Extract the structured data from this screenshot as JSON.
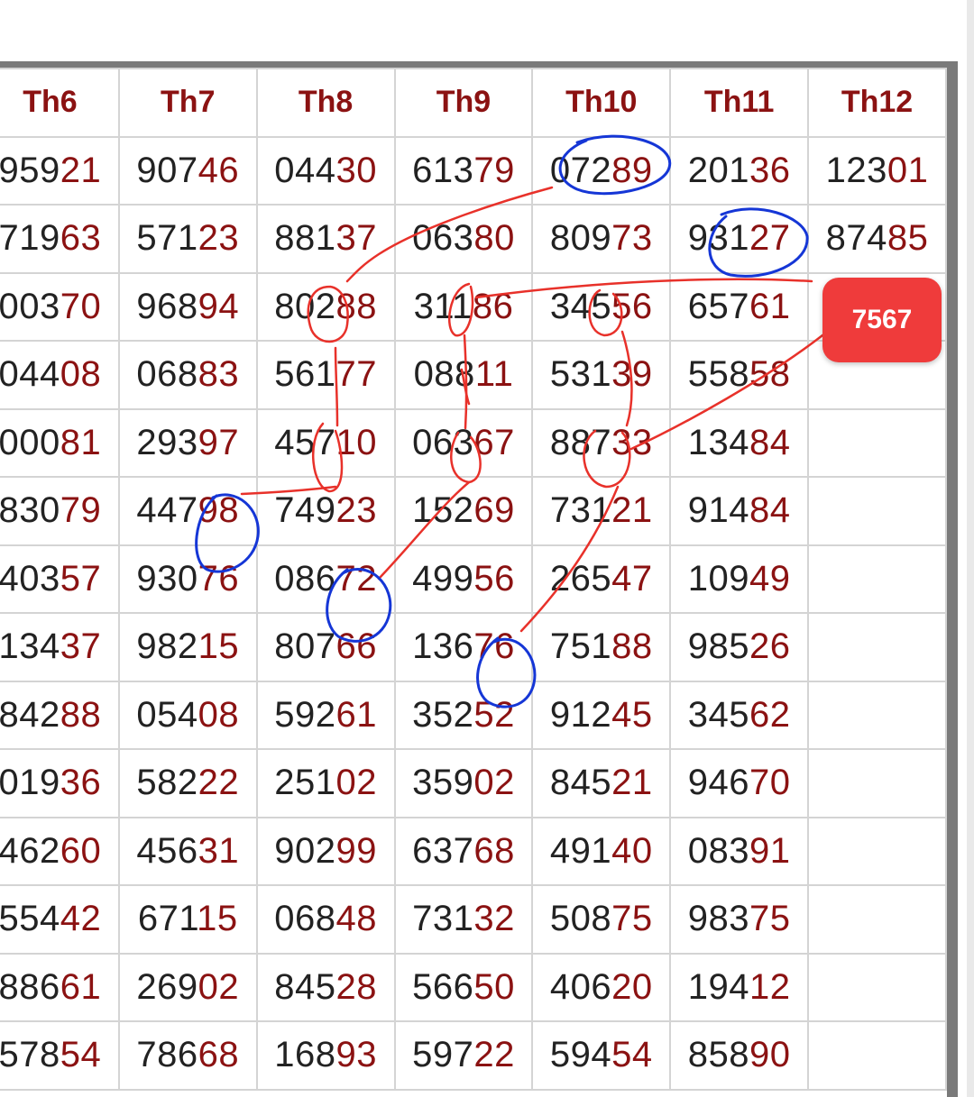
{
  "table": {
    "headers": [
      "Th6",
      "Th7",
      "Th8",
      "Th9",
      "Th10",
      "Th11",
      "Th12"
    ],
    "rows": [
      [
        [
          "959",
          "21",
          ""
        ],
        [
          "907",
          "46",
          ""
        ],
        [
          "044",
          "30",
          ""
        ],
        [
          "613",
          "79",
          ""
        ],
        [
          "072",
          "89",
          "orange"
        ],
        [
          "201",
          "36",
          ""
        ],
        [
          "123",
          "01",
          ""
        ]
      ],
      [
        [
          "719",
          "63",
          ""
        ],
        [
          "571",
          "23",
          "green"
        ],
        [
          "881",
          "37",
          ""
        ],
        [
          "063",
          "80",
          ""
        ],
        [
          "809",
          "73",
          ""
        ],
        [
          "931",
          "27",
          "orange"
        ],
        [
          "874",
          "85",
          ""
        ]
      ],
      [
        [
          "003",
          "70",
          ""
        ],
        [
          "968",
          "94",
          ""
        ],
        [
          "802",
          "88",
          ""
        ],
        [
          "311",
          "86",
          "green"
        ],
        [
          "345",
          "56",
          ""
        ],
        [
          "657",
          "61",
          ""
        ],
        [
          "",
          "",
          "orange"
        ]
      ],
      [
        [
          "044",
          "08",
          "green"
        ],
        [
          "068",
          "83",
          ""
        ],
        [
          "561",
          "77",
          ""
        ],
        [
          "088",
          "11",
          ""
        ],
        [
          "531",
          "39",
          ""
        ],
        [
          "558",
          "58",
          ""
        ],
        [
          "",
          "",
          ""
        ]
      ],
      [
        [
          "000",
          "81",
          ""
        ],
        [
          "293",
          "97",
          ""
        ],
        [
          "457",
          "10",
          ""
        ],
        [
          "063",
          "67",
          ""
        ],
        [
          "887",
          "33",
          ""
        ],
        [
          "134",
          "84",
          "green"
        ],
        [
          "",
          "",
          ""
        ]
      ],
      [
        [
          "830",
          "79",
          ""
        ],
        [
          "447",
          "98",
          "orange"
        ],
        [
          "749",
          "23",
          "green"
        ],
        [
          "152",
          "69",
          ""
        ],
        [
          "731",
          "21",
          ""
        ],
        [
          "914",
          "84",
          ""
        ],
        [
          "",
          "",
          ""
        ]
      ],
      [
        [
          "403",
          "57",
          ""
        ],
        [
          "930",
          "76",
          ""
        ],
        [
          "086",
          "72",
          "orange"
        ],
        [
          "499",
          "56",
          ""
        ],
        [
          "265",
          "47",
          ""
        ],
        [
          "109",
          "49",
          ""
        ],
        [
          "",
          "",
          ""
        ]
      ],
      [
        [
          "134",
          "37",
          ""
        ],
        [
          "982",
          "15",
          ""
        ],
        [
          "807",
          "66",
          ""
        ],
        [
          "136",
          "76",
          "orange"
        ],
        [
          "751",
          "88",
          "green"
        ],
        [
          "985",
          "26",
          ""
        ],
        [
          "",
          "",
          ""
        ]
      ],
      [
        [
          "842",
          "88",
          ""
        ],
        [
          "054",
          "08",
          "green"
        ],
        [
          "592",
          "61",
          ""
        ],
        [
          "352",
          "52",
          ""
        ],
        [
          "912",
          "45",
          ""
        ],
        [
          "345",
          "62",
          ""
        ],
        [
          "",
          "",
          ""
        ]
      ],
      [
        [
          "019",
          "36",
          ""
        ],
        [
          "582",
          "22",
          ""
        ],
        [
          "251",
          "02",
          ""
        ],
        [
          "359",
          "02",
          "green"
        ],
        [
          "845",
          "21",
          ""
        ],
        [
          "946",
          "70",
          ""
        ],
        [
          "",
          "",
          "green"
        ]
      ],
      [
        [
          "462",
          "60",
          "green"
        ],
        [
          "456",
          "31",
          ""
        ],
        [
          "902",
          "99",
          ""
        ],
        [
          "637",
          "68",
          ""
        ],
        [
          "491",
          "40",
          ""
        ],
        [
          "083",
          "91",
          ""
        ],
        [
          "",
          "",
          "lightorange"
        ]
      ],
      [
        [
          "554",
          "42",
          ""
        ],
        [
          "671",
          "15",
          ""
        ],
        [
          "068",
          "48",
          ""
        ],
        [
          "731",
          "32",
          ""
        ],
        [
          "508",
          "75",
          ""
        ],
        [
          "983",
          "75",
          "green"
        ],
        [
          "",
          "",
          ""
        ]
      ],
      [
        [
          "886",
          "61",
          ""
        ],
        [
          "269",
          "02",
          ""
        ],
        [
          "845",
          "28",
          "green"
        ],
        [
          "566",
          "50",
          ""
        ],
        [
          "406",
          "20",
          ""
        ],
        [
          "194",
          "12",
          ""
        ],
        [
          "",
          "",
          ""
        ]
      ],
      [
        [
          "578",
          "54",
          ""
        ],
        [
          "786",
          "68",
          ""
        ],
        [
          "168",
          "93",
          ""
        ],
        [
          "597",
          "22",
          ""
        ],
        [
          "594",
          "54",
          ""
        ],
        [
          "858",
          "90",
          ""
        ],
        [
          "",
          "",
          ""
        ]
      ]
    ]
  },
  "badge": {
    "text": "7567"
  },
  "colors": {
    "header_text": "#8b1212",
    "suffix_digits": "#8b1212",
    "highlight_green": "#e2f0d9",
    "highlight_orange": "#ffc000",
    "highlight_light_orange": "#ffe8a3",
    "badge_bg": "#ef3b3b",
    "annotation_red": "#e8312a",
    "annotation_blue": "#1536d6"
  }
}
